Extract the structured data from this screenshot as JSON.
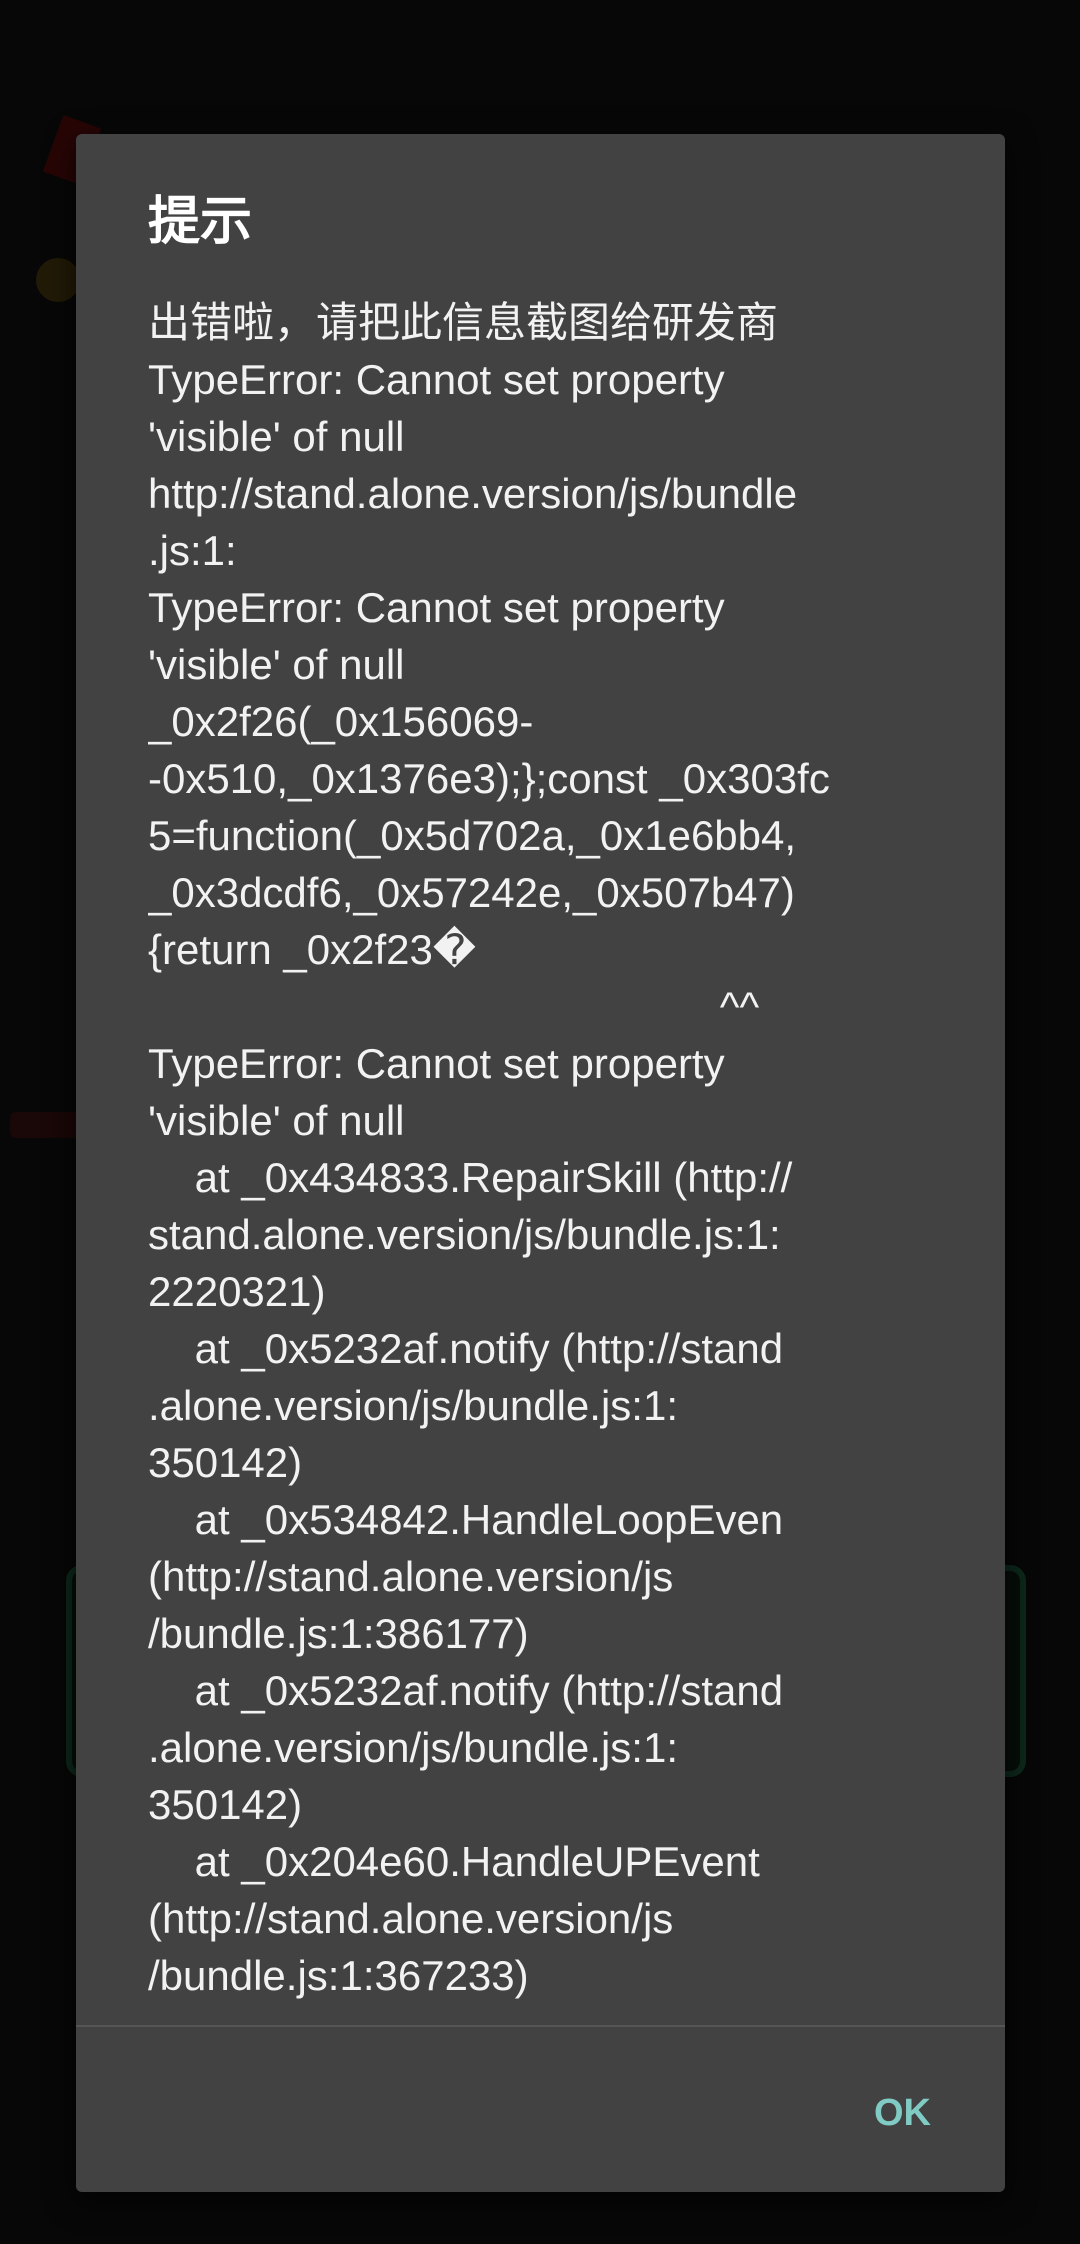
{
  "dialog": {
    "title": "提示",
    "message_lines": [
      "出错啦，请把此信息截图给研发商",
      "TypeError: Cannot set property",
      "'visible' of null",
      "http://stand.alone.version/js/bundle",
      ".js:1:",
      "TypeError: Cannot set property",
      "'visible' of null",
      "_0x2f26(_0x156069-",
      "-0x510,_0x1376e3);};const _0x303fc",
      "5=function(_0x5d702a,_0x1e6bb4,",
      "_0x3dcdf6,_0x57242e,_0x507b47)",
      "{return _0x2f23�",
      "                                                 ^^",
      "TypeError: Cannot set property",
      "'visible' of null",
      "    at _0x434833.RepairSkill (http://",
      "stand.alone.version/js/bundle.js:1:",
      "2220321)",
      "    at _0x5232af.notify (http://stand",
      ".alone.version/js/bundle.js:1:",
      "350142)",
      "    at _0x534842.HandleLoopEven",
      "(http://stand.alone.version/js",
      "/bundle.js:1:386177)",
      "    at _0x5232af.notify (http://stand",
      ".alone.version/js/bundle.js:1:",
      "350142)",
      "    at _0x204e60.HandleUPEvent",
      "(http://stand.alone.version/js",
      "/bundle.js:1:367233)"
    ],
    "ok_label": "OK"
  },
  "colors": {
    "dialog_bg": "#424242",
    "scrim": "#000000",
    "title_text": "#ffffff",
    "body_text": "#f2f2f2",
    "accent": "#80cbc4"
  }
}
